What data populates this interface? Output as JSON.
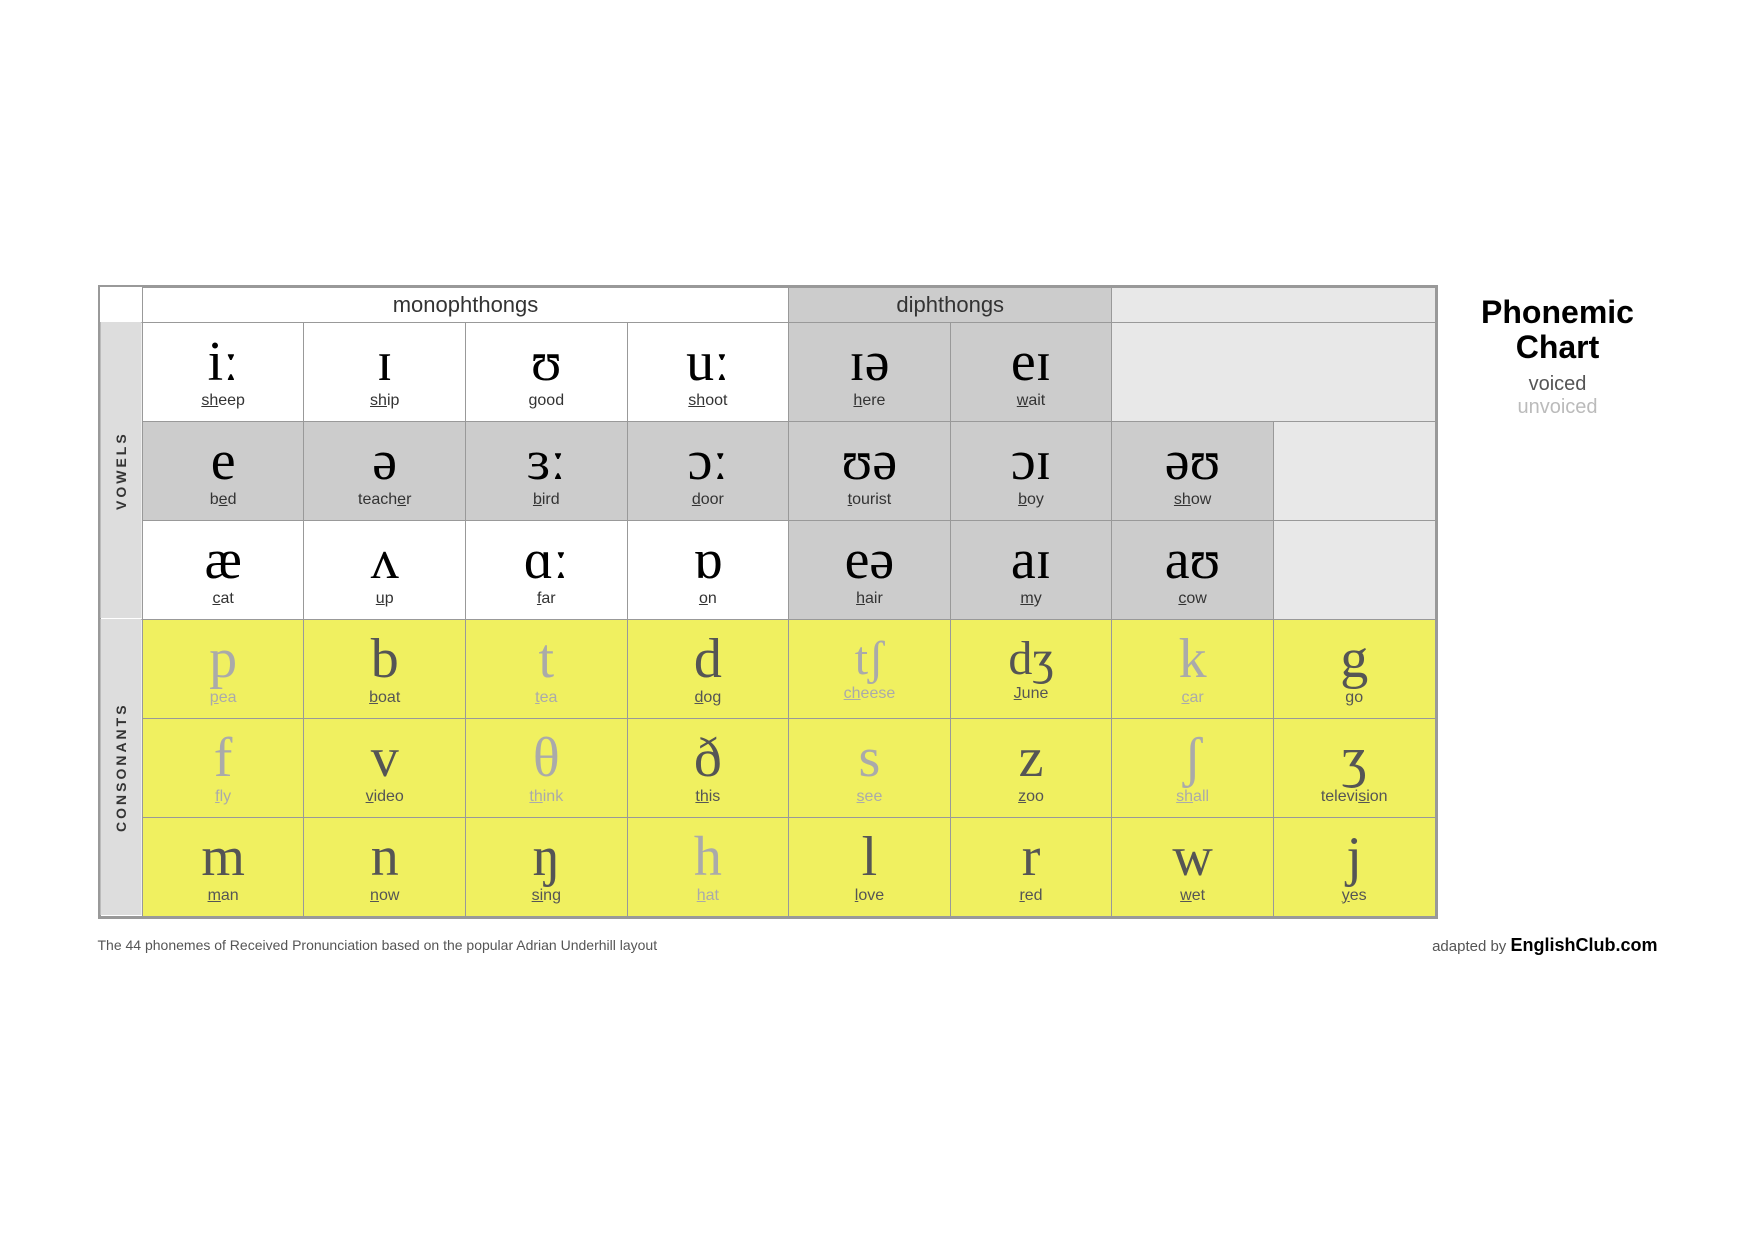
{
  "title": {
    "main": "Phonemic Chart",
    "voiced": "voiced",
    "unvoiced": "unvoiced"
  },
  "headers": {
    "monophthongs": "monophthongs",
    "diphthongs": "diphthongs"
  },
  "labels": {
    "vowels": "VOWELS",
    "consonants": "CONSONANTS"
  },
  "vowel_rows": [
    [
      {
        "symbol": "iː",
        "word": "sheep",
        "ul": 0
      },
      {
        "symbol": "ɪ",
        "word": "ship",
        "ul": 0
      },
      {
        "symbol": "ʊ",
        "word": "good",
        "ul": 0
      },
      {
        "symbol": "uː",
        "word": "shoot",
        "ul": 0
      },
      {
        "symbol": "ɪə",
        "word": "here",
        "ul": 0
      },
      {
        "symbol": "eɪ",
        "word": "wait",
        "ul": 0
      }
    ],
    [
      {
        "symbol": "e",
        "word": "bed",
        "ul": 1
      },
      {
        "symbol": "ə",
        "word": "teacher",
        "ul": 6
      },
      {
        "symbol": "ɜː",
        "word": "bird",
        "ul": 0
      },
      {
        "symbol": "ɔː",
        "word": "door",
        "ul": 0
      },
      {
        "symbol": "ʊə",
        "word": "tourist",
        "ul": 0
      },
      {
        "symbol": "ɔɪ",
        "word": "boy",
        "ul": 1
      },
      {
        "symbol": "əʊ",
        "word": "show",
        "ul": 0
      }
    ],
    [
      {
        "symbol": "æ",
        "word": "cat",
        "ul": 1
      },
      {
        "symbol": "ʌ",
        "word": "up",
        "ul": 0
      },
      {
        "symbol": "ɑː",
        "word": "far",
        "ul": 0
      },
      {
        "symbol": "ɒ",
        "word": "on",
        "ul": 0
      },
      {
        "symbol": "eə",
        "word": "hair",
        "ul": 0
      },
      {
        "symbol": "aɪ",
        "word": "my",
        "ul": 1
      },
      {
        "symbol": "aʊ",
        "word": "cow",
        "ul": 0
      }
    ]
  ],
  "consonant_rows": [
    [
      {
        "symbol": "p",
        "word": "pea",
        "ul": 0,
        "voiced": false
      },
      {
        "symbol": "b",
        "word": "boat",
        "ul": 0,
        "voiced": true
      },
      {
        "symbol": "t",
        "word": "tea",
        "ul": 0,
        "voiced": false
      },
      {
        "symbol": "d",
        "word": "dog",
        "ul": 0,
        "voiced": true
      },
      {
        "symbol": "tʃ",
        "word": "cheese",
        "ul": 0,
        "voiced": false
      },
      {
        "symbol": "dʒ",
        "word": "June",
        "ul": 0,
        "voiced": true
      },
      {
        "symbol": "k",
        "word": "car",
        "ul": 0,
        "voiced": false
      },
      {
        "symbol": "g",
        "word": "go",
        "ul": 0,
        "voiced": true
      }
    ],
    [
      {
        "symbol": "f",
        "word": "fly",
        "ul": 0,
        "voiced": false
      },
      {
        "symbol": "v",
        "word": "video",
        "ul": 0,
        "voiced": true
      },
      {
        "symbol": "θ",
        "word": "think",
        "ul": 0,
        "voiced": false
      },
      {
        "symbol": "ð",
        "word": "this",
        "ul": 0,
        "voiced": true
      },
      {
        "symbol": "s",
        "word": "see",
        "ul": 0,
        "voiced": false
      },
      {
        "symbol": "z",
        "word": "zoo",
        "ul": 0,
        "voiced": true
      },
      {
        "symbol": "ʃ",
        "word": "shall",
        "ul": 0,
        "voiced": false
      },
      {
        "symbol": "ʒ",
        "word": "television",
        "ul": 0,
        "voiced": true
      }
    ],
    [
      {
        "symbol": "m",
        "word": "man",
        "ul": 0,
        "voiced": true
      },
      {
        "symbol": "n",
        "word": "now",
        "ul": 0,
        "voiced": true
      },
      {
        "symbol": "ŋ",
        "word": "sing",
        "ul": 0,
        "voiced": true
      },
      {
        "symbol": "h",
        "word": "hat",
        "ul": 0,
        "voiced": false
      },
      {
        "symbol": "l",
        "word": "love",
        "ul": 0,
        "voiced": true
      },
      {
        "symbol": "r",
        "word": "red",
        "ul": 0,
        "voiced": true
      },
      {
        "symbol": "w",
        "word": "wet",
        "ul": 0,
        "voiced": true
      },
      {
        "symbol": "j",
        "word": "yes",
        "ul": 0,
        "voiced": true
      }
    ]
  ],
  "footnote": "The 44 phonemes of Received Pronunciation based on the popular Adrian Underhill layout",
  "credit_prefix": "adapted by ",
  "credit_site": "EnglishClub.com"
}
